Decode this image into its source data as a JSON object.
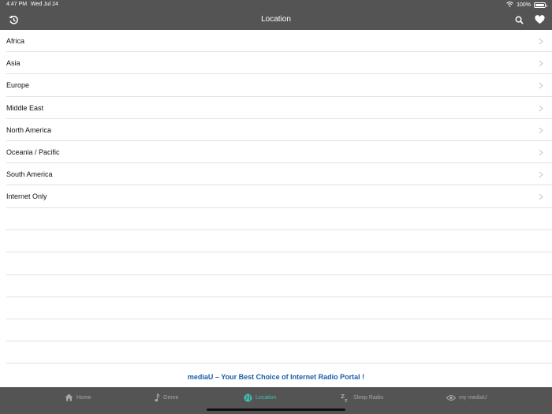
{
  "status_bar": {
    "time": "4:47 PM",
    "date": "Wed Jul 24",
    "battery": "100%",
    "battery_level": 1.0,
    "wifi_icon": "wifi-icon",
    "battery_icon": "battery-icon"
  },
  "header": {
    "title": "Location",
    "left_icon": "history-icon",
    "right_icons": [
      "search-icon",
      "heart-icon"
    ],
    "background": "#545454"
  },
  "list": {
    "items": [
      {
        "label": "Africa"
      },
      {
        "label": "Asia"
      },
      {
        "label": "Europe"
      },
      {
        "label": "Middle East"
      },
      {
        "label": "North America"
      },
      {
        "label": "Oceania / Pacific"
      },
      {
        "label": "South America"
      },
      {
        "label": "Internet Only"
      }
    ],
    "row_icon": "chevron-right-icon"
  },
  "footer": {
    "tagline": "mediaU – Your Best Choice of Internet Radio Portal !",
    "tagline_color": "#1b5ea8"
  },
  "tabbar": {
    "active_color": "#3fc3b4",
    "inactive_color": "#a6a6a6",
    "tabs": [
      {
        "label": "Home",
        "icon": "home-icon",
        "active": false
      },
      {
        "label": "Genre",
        "icon": "music-note-icon",
        "active": false
      },
      {
        "label": "Location",
        "icon": "globe-icon",
        "active": true
      },
      {
        "label": "Sleep Radio",
        "icon": "sleep-icon",
        "active": false
      },
      {
        "label": "my mediaU",
        "icon": "eye-icon",
        "active": false
      }
    ]
  }
}
